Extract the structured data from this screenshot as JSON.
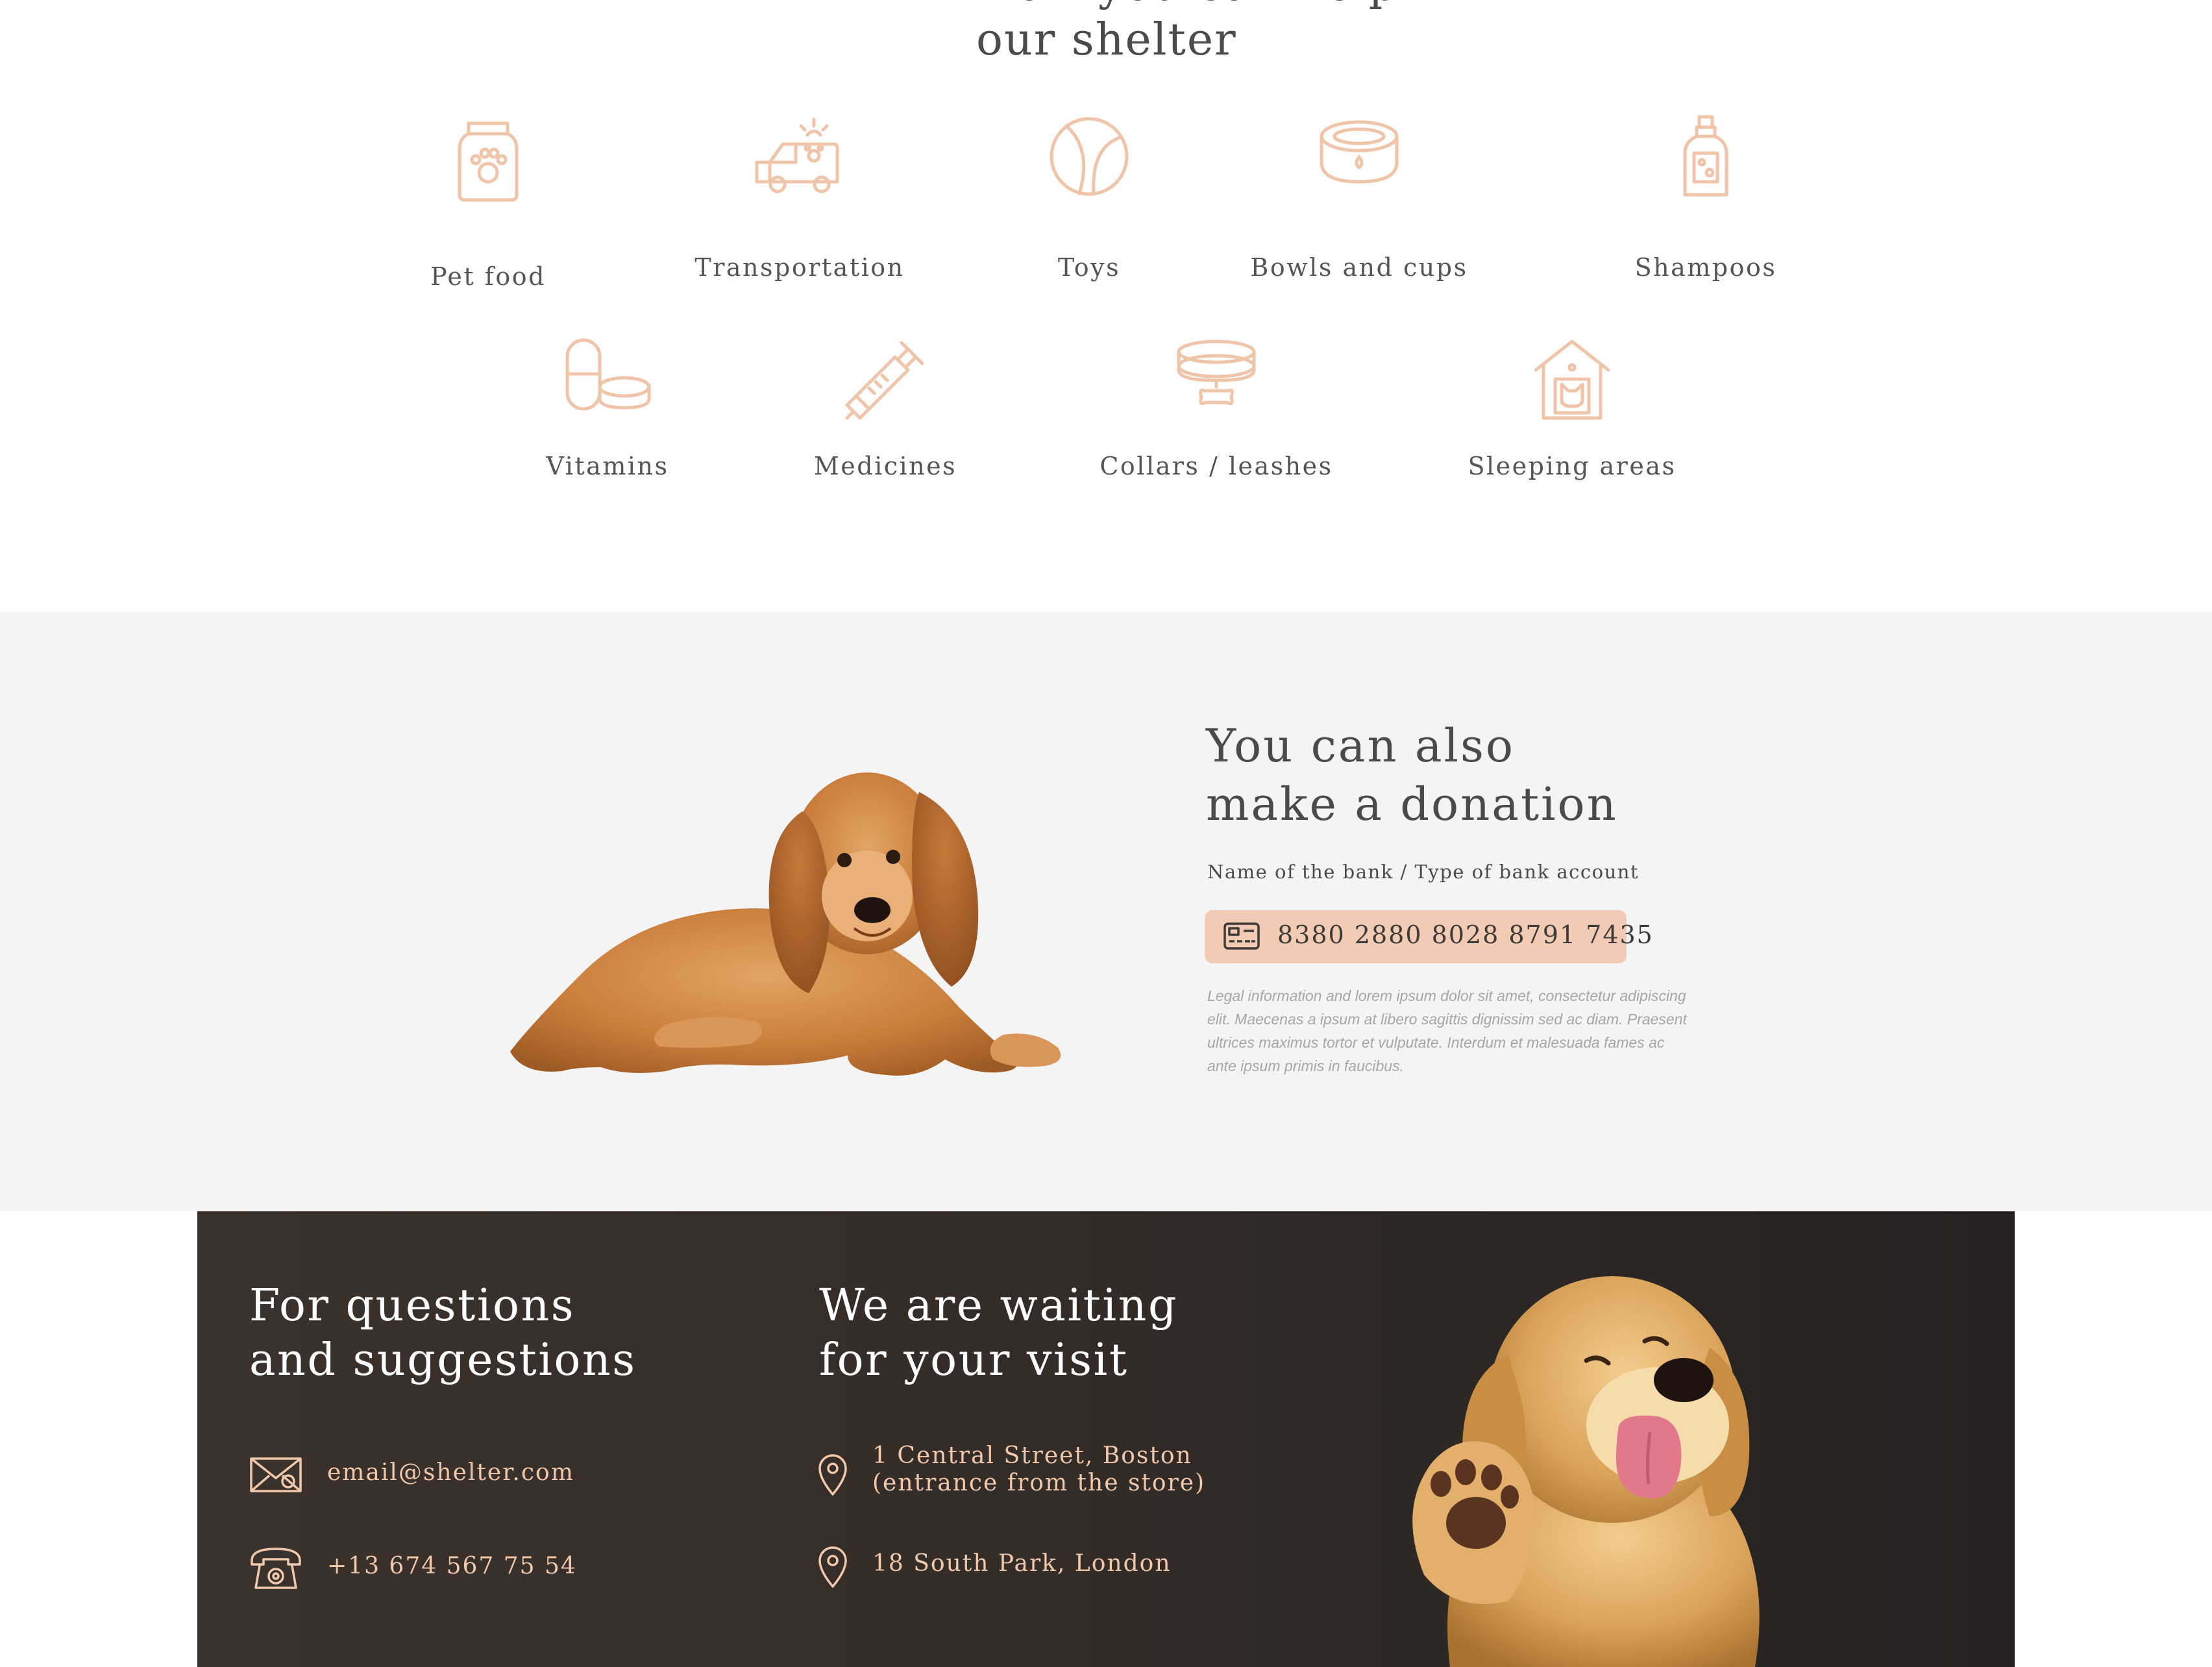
{
  "help": {
    "title_line1": "How you can help",
    "title_line2": "our shelter",
    "items": [
      {
        "label": "Pet food",
        "icon": "pet-food-bag-icon"
      },
      {
        "label": "Transportation",
        "icon": "pet-van-icon"
      },
      {
        "label": "Toys",
        "icon": "ball-icon"
      },
      {
        "label": "Bowls and cups",
        "icon": "bowl-icon"
      },
      {
        "label": "Shampoos",
        "icon": "shampoo-bottle-icon"
      },
      {
        "label": "Vitamins",
        "icon": "pills-icon"
      },
      {
        "label": "Medicines",
        "icon": "syringe-icon"
      },
      {
        "label": "Collars / leashes",
        "icon": "collar-icon"
      },
      {
        "label": "Sleeping areas",
        "icon": "pet-house-icon"
      }
    ],
    "icon_color": "#efc4a8"
  },
  "donation": {
    "title_line1": "You can also",
    "title_line2": "make a donation",
    "bank_label": "Name of the bank / Type of bank account",
    "account_number": "8380 2880 8028 8791 7435",
    "legal_text": "Legal information and lorem ipsum dolor sit amet, consectetur adipiscing elit. Maecenas a ipsum at libero sagittis dignissim sed ac diam. Praesent ultrices maximus tortor et vulputate. Interdum et malesuada fames ac ante ipsum primis in faucibus.",
    "box_color": "#f1cbb3"
  },
  "contact": {
    "questions_title_line1": "For questions",
    "questions_title_line2": "and suggestions",
    "email": "email@shelter.com",
    "phone": "+13 674 567 75 54",
    "visit_title_line1": "We are waiting",
    "visit_title_line2": "for your visit",
    "address1_line1": "1 Central Street, Boston",
    "address1_line2": "(entrance from the store)",
    "address2": "18 South Park, London",
    "accent_color": "#f0c9ad"
  }
}
